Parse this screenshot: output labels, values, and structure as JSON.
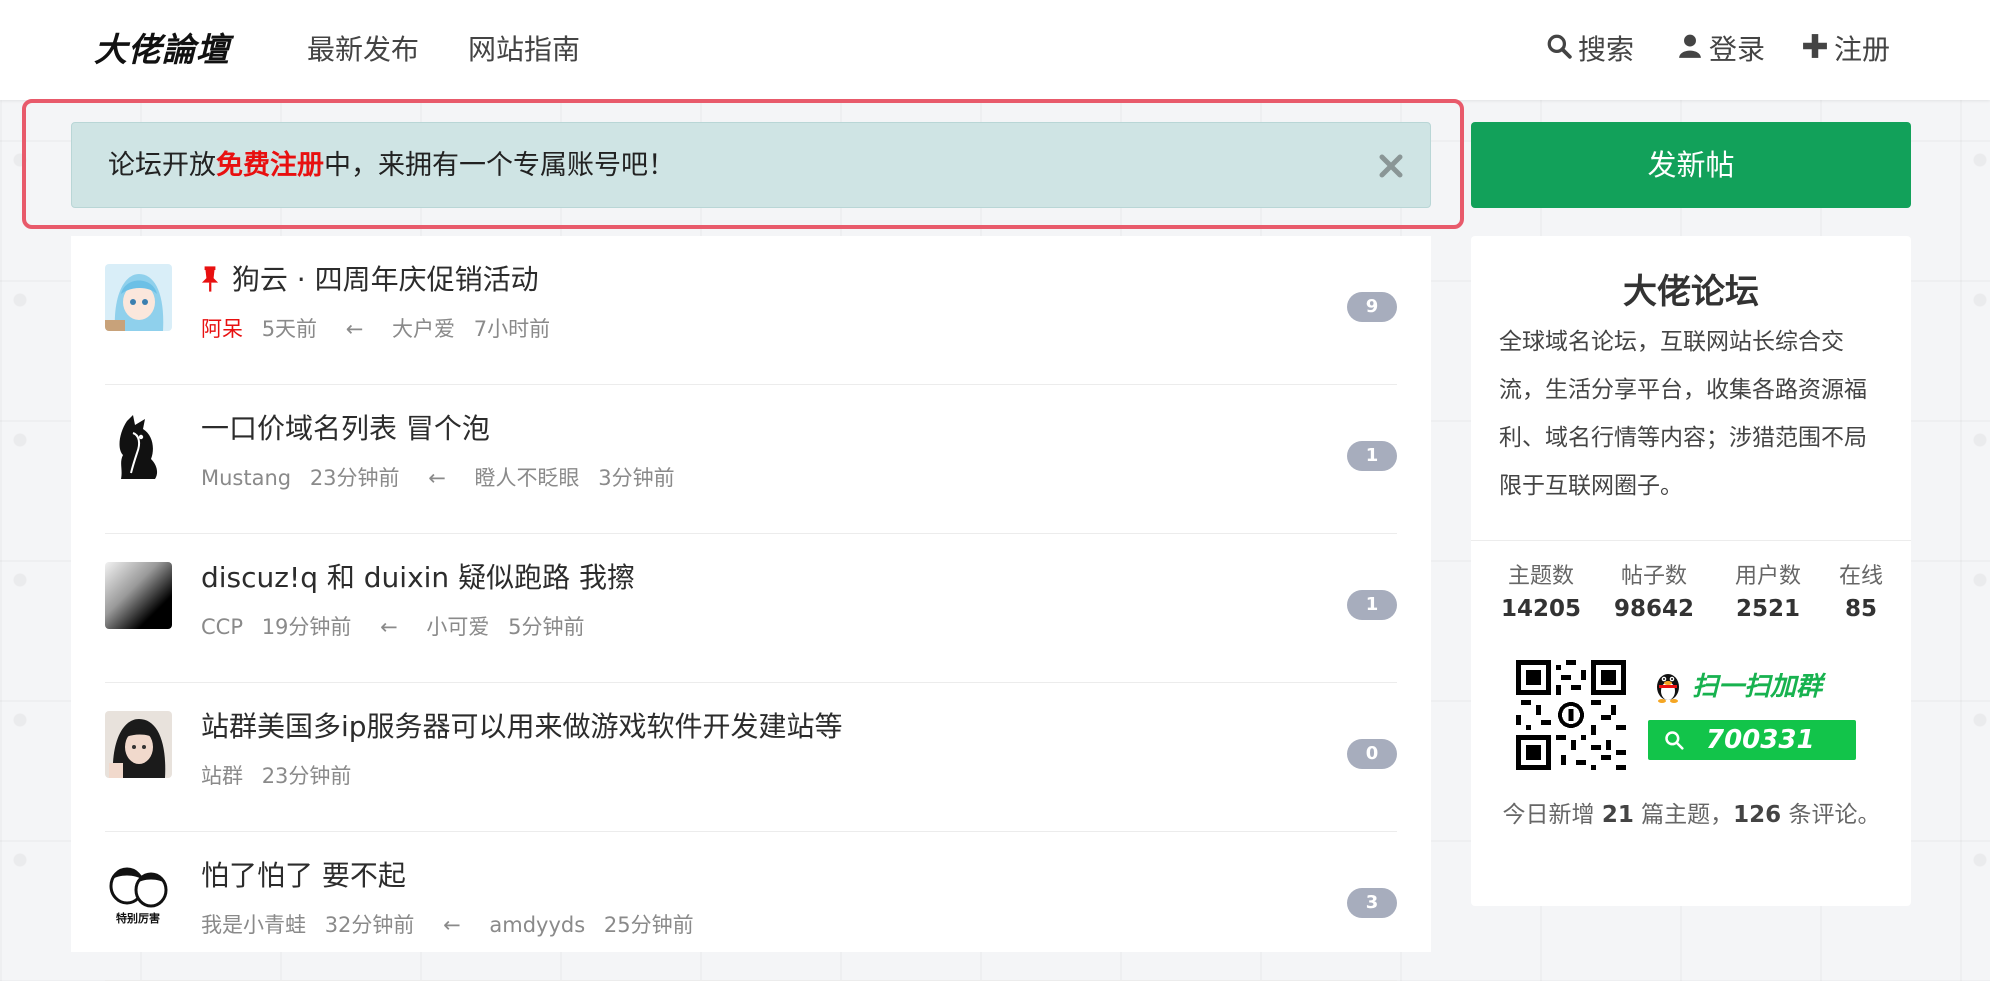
{
  "header": {
    "logo_text": "大佬論壇",
    "nav": [
      {
        "label": "最新发布"
      },
      {
        "label": "网站指南"
      }
    ],
    "search_label": "搜索",
    "login_label": "登录",
    "register_label": "注册"
  },
  "notice": {
    "prefix": "论坛开放",
    "highlight": "免费注册",
    "suffix": "中，来拥有一个专属账号吧！",
    "close_symbol": "×"
  },
  "new_post_label": "发新帖",
  "topics": [
    {
      "pinned": true,
      "title": "狗云 · 四周年庆促销活动",
      "author": "阿呆",
      "author_highlight": true,
      "posted": "5天前",
      "last_reply_user": "大户爱",
      "last_reply_time": "7小时前",
      "replies": "9"
    },
    {
      "pinned": false,
      "title": "一口价域名列表 冒个泡",
      "author": "Mustang",
      "posted": "23分钟前",
      "last_reply_user": "瞪人不眨眼",
      "last_reply_time": "3分钟前",
      "replies": "1"
    },
    {
      "pinned": false,
      "title": "discuz!q 和 duixin 疑似跑路 我擦",
      "author": "CCP",
      "posted": "19分钟前",
      "last_reply_user": "小可爱",
      "last_reply_time": "5分钟前",
      "replies": "1"
    },
    {
      "pinned": false,
      "title": "站群美国多ip服务器可以用来做游戏软件开发建站等",
      "author": "站群",
      "posted": "23分钟前",
      "last_reply_user": "",
      "last_reply_time": "",
      "replies": "0"
    },
    {
      "pinned": false,
      "title": "怕了怕了 要不起",
      "author": "我是小青蛙",
      "posted": "32分钟前",
      "last_reply_user": "amdyyds",
      "last_reply_time": "25分钟前",
      "replies": "3"
    }
  ],
  "sidebar": {
    "title": "大佬论坛",
    "description": "全球域名论坛，互联网站长综合交流，生活分享平台，收集各路资源福利、域名行情等内容；涉猎范围不局限于互联网圈子。",
    "stats": [
      {
        "label": "主题数",
        "value": "14205"
      },
      {
        "label": "帖子数",
        "value": "98642"
      },
      {
        "label": "用户数",
        "value": "2521"
      },
      {
        "label": "在线",
        "value": "85"
      }
    ],
    "qq_slogan": "扫一扫加群",
    "qq_group": "700331",
    "today_prefix": "今日新增",
    "today_topics": "21",
    "today_mid": "篇主题，",
    "today_comments": "126",
    "today_suffix": "条评论。"
  },
  "colors": {
    "accent_green": "#12a15a",
    "highlight_red": "#e81010",
    "notice_bg": "#cfe4e4",
    "badge_bg": "#a7adbd"
  }
}
